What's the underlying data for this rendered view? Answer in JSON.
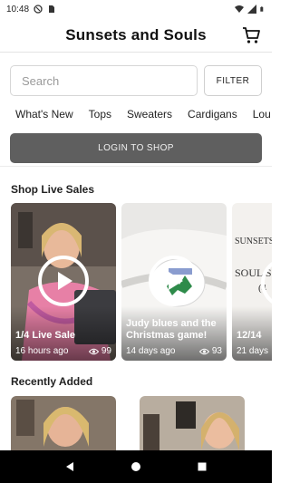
{
  "status": {
    "time": "10:48"
  },
  "header": {
    "title": "Sunsets and Souls",
    "cart_icon": "shopping-cart-icon"
  },
  "search": {
    "placeholder": "Search",
    "value": "",
    "filter_label": "FILTER"
  },
  "categories": [
    "What's New",
    "Tops",
    "Sweaters",
    "Cardigans",
    "Lou"
  ],
  "login": {
    "label": "LOGIN TO SHOP"
  },
  "live_sales": {
    "title": "Shop Live Sales",
    "cards": [
      {
        "caption": "1/4 Live Sale",
        "age": "16 hours ago",
        "views": "99"
      },
      {
        "caption": "Judy blues and the Christmas game!",
        "age": "14 days ago",
        "views": "93"
      },
      {
        "caption": "12/14",
        "age": "21 days",
        "views": "",
        "poster_lines": [
          "SUNSETS",
          "SOUL S",
          "(4"
        ]
      }
    ]
  },
  "recent": {
    "title": "Recently Added"
  },
  "colors": {
    "login_bg": "#5f5f5f",
    "nav_bg": "#000000",
    "header_border": "#e3e3e3"
  }
}
